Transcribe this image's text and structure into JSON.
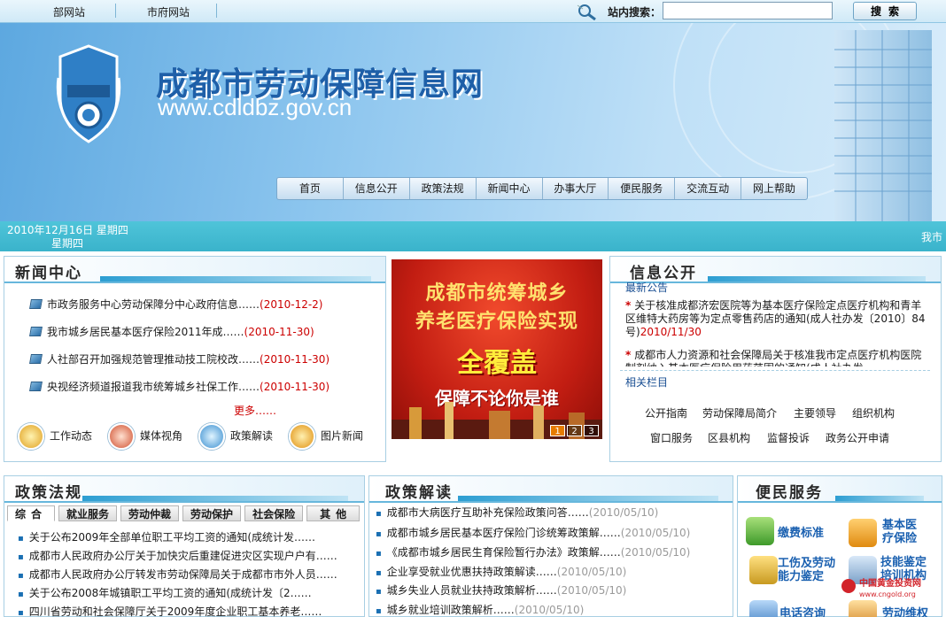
{
  "topbar": {
    "links": [
      "部网站",
      "市府网站"
    ],
    "search_label": "站内搜索：",
    "search_value": "",
    "search_button": "搜索"
  },
  "banner": {
    "title": "成都市劳动保障信息网",
    "url": "www.cdldbz.gov.cn"
  },
  "nav": [
    "首页",
    "信息公开",
    "政策法规",
    "新闻中心",
    "办事大厅",
    "便民服务",
    "交流互动",
    "网上帮助"
  ],
  "datebar": {
    "line1": "2010年12月16日  星期四",
    "line2": "星期四",
    "marquee": "我市"
  },
  "news": {
    "title": "新闻中心",
    "items": [
      {
        "text": "市政务服务中心劳动保障分中心政府信息……",
        "date": "(2010-12-2)"
      },
      {
        "text": "我市城乡居民基本医疗保险2011年成……",
        "date": "(2010-11-30)"
      },
      {
        "text": "人社部召开加强规范管理推动技工院校改……",
        "date": "(2010-11-30)"
      },
      {
        "text": "央视经济频道报道我市统筹城乡社保工作……",
        "date": "(2010-11-30)"
      }
    ],
    "more": "更多……",
    "categories": [
      "工作动态",
      "媒体视角",
      "政策解读",
      "图片新闻"
    ]
  },
  "promo": {
    "line1": "成都市统筹城乡",
    "line2": "养老医疗保险实现",
    "line3": "全覆盖",
    "line4": "保障不论你是谁",
    "pages": [
      "1",
      "2",
      "3"
    ]
  },
  "info": {
    "title": "信息公开",
    "latest_label": "最新公告",
    "notice1": "关于核准成都济宏医院等为基本医疗保险定点医疗机构和青羊区维特大药房等为定点零售药店的通知(成人社办发〔2010〕84号)",
    "notice1_date": "2010/11/30",
    "notice2": "成都市人力资源和社会保障局关于核准我市定点医疗机构医院制剂纳入基本医疗保险用药范围的通知(成人社办发",
    "related_label": "相关栏目",
    "links_row1": [
      "公开指南",
      "劳动保障局简介",
      "主要领导",
      "组织机构"
    ],
    "links_row2": [
      "窗口服务",
      "区县机构",
      "监督投诉",
      "政务公开申请"
    ]
  },
  "law": {
    "title": "政策法规",
    "tabs": [
      "综合",
      "就业服务",
      "劳动仲裁",
      "劳动保护",
      "社会保险",
      "其他"
    ],
    "items": [
      "关于公布2009年全部单位职工平均工资的通知(成统计发……",
      "成都市人民政府办公厅关于加快灾后重建促进灾区实现户户有……",
      "成都市人民政府办公厅转发市劳动保障局关于成都市市外人员……",
      "关于公布2008年城镇职工平均工资的通知(成统计发〔2……",
      "四川省劳动和社会保障厅关于2009年度企业职工基本养老……"
    ]
  },
  "interp": {
    "title": "政策解读",
    "items": [
      {
        "text": "成都市大病医疗互助补充保险政策问答……",
        "date": "(2010/05/10)"
      },
      {
        "text": "成都市城乡居民基本医疗保险门诊统筹政策解……",
        "date": "(2010/05/10)"
      },
      {
        "text": "《成都市城乡居民生育保险暂行办法》政策解……",
        "date": "(2010/05/10)"
      },
      {
        "text": "企业享受就业优惠扶持政策解读……",
        "date": "(2010/05/10)"
      },
      {
        "text": "城乡失业人员就业扶持政策解析……",
        "date": "(2010/05/10)"
      },
      {
        "text": "城乡就业培训政策解析……",
        "date": "(2010/05/10)"
      }
    ]
  },
  "service": {
    "title": "便民服务",
    "items": [
      "缴费标准",
      "基本医疗保险",
      "工伤及劳动能力鉴定",
      "技能鉴定培训机构",
      "电话咨询",
      "劳动维权"
    ]
  },
  "watermark": "中国黄金投资网 www.cngold.org"
}
